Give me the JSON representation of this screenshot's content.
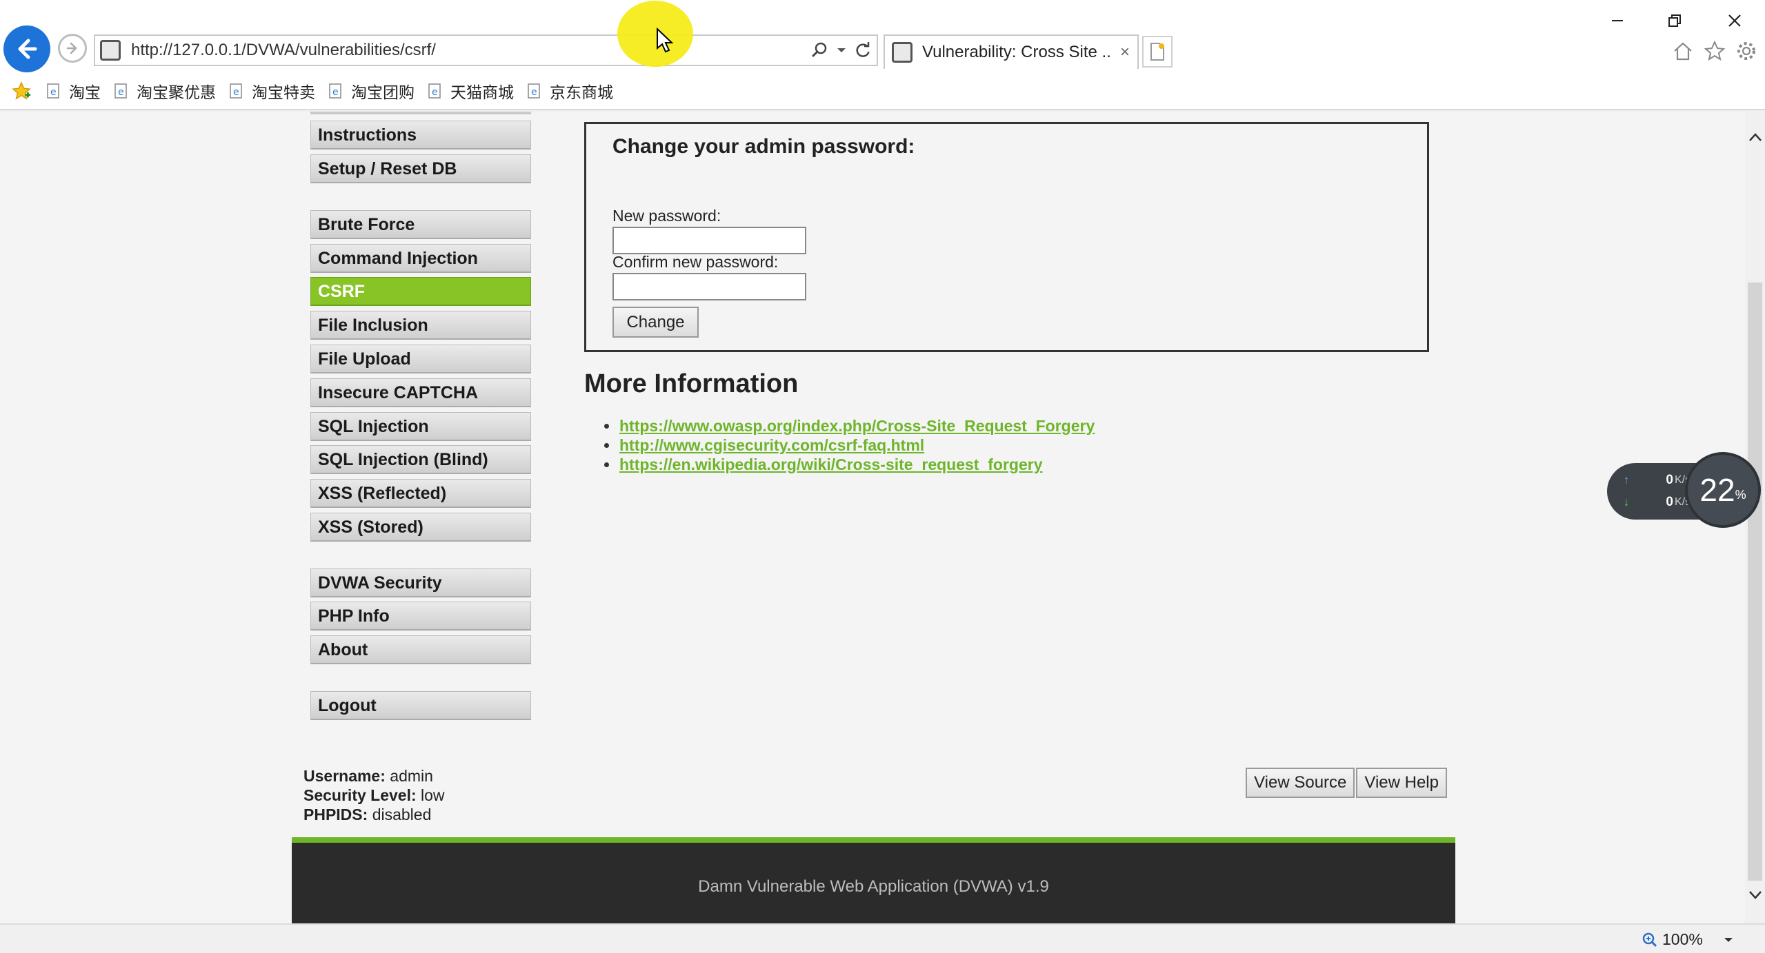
{
  "browser": {
    "url": "http://127.0.0.1/DVWA/vulnerabilities/csrf/",
    "tab_title": "Vulnerability: Cross Site ...",
    "tab_close": "×",
    "favorites": [
      {
        "label": "淘宝"
      },
      {
        "label": "淘宝聚优惠"
      },
      {
        "label": "淘宝特卖"
      },
      {
        "label": "淘宝团购"
      },
      {
        "label": "天猫商城"
      },
      {
        "label": "京东商城"
      }
    ],
    "zoom": "100%"
  },
  "menu": {
    "items": [
      {
        "label": "Instructions"
      },
      {
        "label": "Setup / Reset DB"
      },
      {
        "label": "Brute Force"
      },
      {
        "label": "Command Injection"
      },
      {
        "label": "CSRF",
        "selected": true
      },
      {
        "label": "File Inclusion"
      },
      {
        "label": "File Upload"
      },
      {
        "label": "Insecure CAPTCHA"
      },
      {
        "label": "SQL Injection"
      },
      {
        "label": "SQL Injection (Blind)"
      },
      {
        "label": "XSS (Reflected)"
      },
      {
        "label": "XSS (Stored)"
      },
      {
        "label": "DVWA Security"
      },
      {
        "label": "PHP Info"
      },
      {
        "label": "About"
      },
      {
        "label": "Logout"
      }
    ]
  },
  "form": {
    "title": "Change your admin password:",
    "new_password_label": "New password:",
    "confirm_password_label": "Confirm new password:",
    "new_password_value": "",
    "confirm_password_value": "",
    "submit_label": "Change"
  },
  "more_info": {
    "title": "More Information",
    "links": [
      "https://www.owasp.org/index.php/Cross-Site_Request_Forgery",
      "http://www.cgisecurity.com/csrf-faq.html",
      "https://en.wikipedia.org/wiki/Cross-site_request_forgery"
    ]
  },
  "system_info": {
    "username_label": "Username:",
    "username": "admin",
    "security_label": "Security Level:",
    "security": "low",
    "phpids_label": "PHPIDS:",
    "phpids": "disabled"
  },
  "buttons": {
    "view_source": "View Source",
    "view_help": "View Help"
  },
  "footer": {
    "text": "Damn Vulnerable Web Application (DVWA) v1.9"
  },
  "speed_widget": {
    "upload": "0",
    "download": "0",
    "unit": "K/s",
    "percent": "22",
    "percent_sign": "%"
  },
  "colors": {
    "accent": "#88c425",
    "link": "#6eb52a",
    "footer_bg": "#2b2b2b",
    "browser_back": "#1e73d8"
  }
}
